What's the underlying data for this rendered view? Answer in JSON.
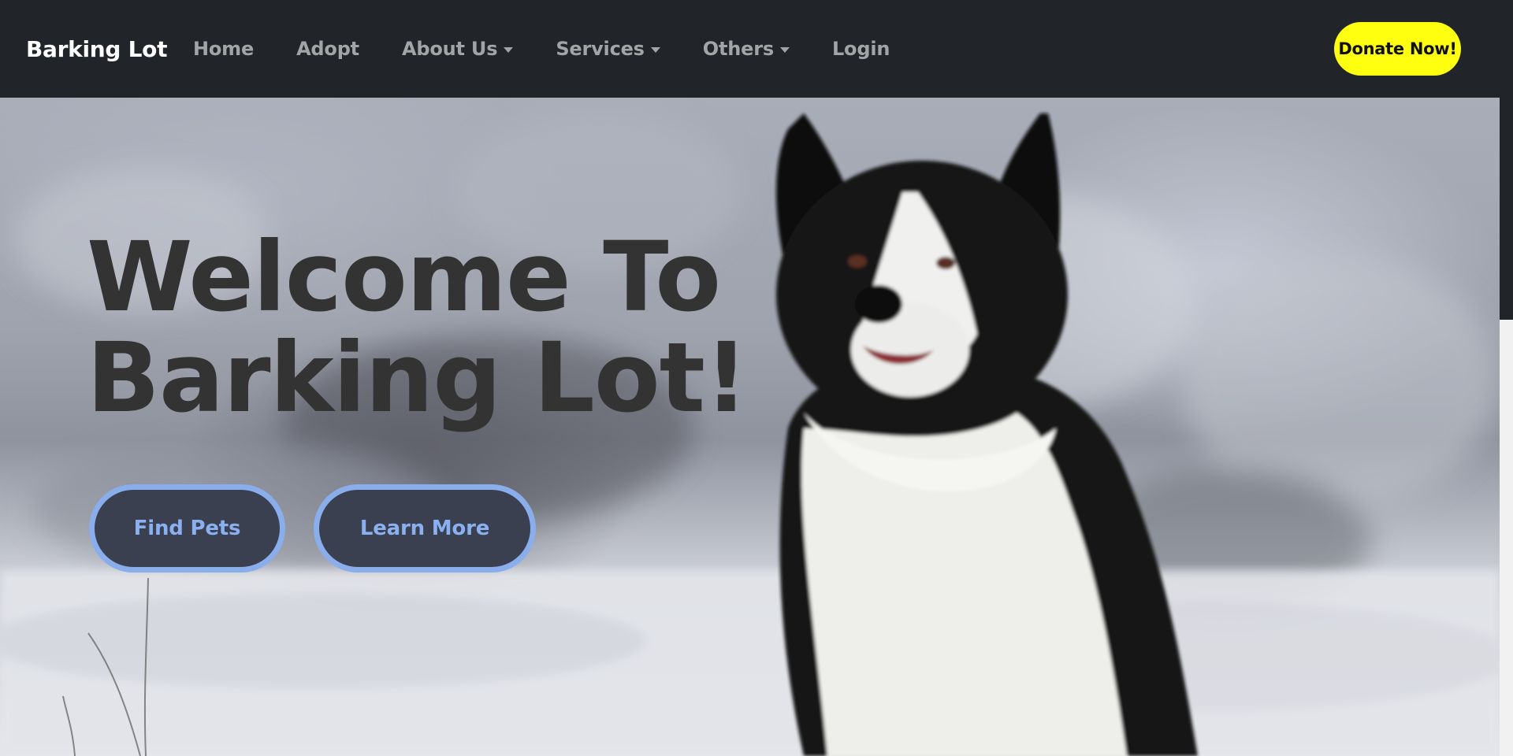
{
  "navbar": {
    "brand": "Barking Lot",
    "links": [
      {
        "label": "Home",
        "dropdown": false
      },
      {
        "label": "Adopt",
        "dropdown": false
      },
      {
        "label": "About Us",
        "dropdown": true
      },
      {
        "label": "Services",
        "dropdown": true
      },
      {
        "label": "Others",
        "dropdown": true
      },
      {
        "label": "Login",
        "dropdown": false
      }
    ],
    "donate_label": "Donate Now!"
  },
  "hero": {
    "title_line1": "Welcome To",
    "title_line2": "Barking Lot!",
    "buttons": {
      "find_pets": "Find Pets",
      "learn_more": "Learn More"
    },
    "image_subject": "black-and-white dog sitting in snow"
  },
  "colors": {
    "navbar_bg": "#212529",
    "nav_link": "#a2a4a6",
    "donate_bg": "#ffff10",
    "hero_title": "#333333",
    "hero_button_bg": "#3a4050",
    "hero_button_accent": "#8aaeec"
  }
}
